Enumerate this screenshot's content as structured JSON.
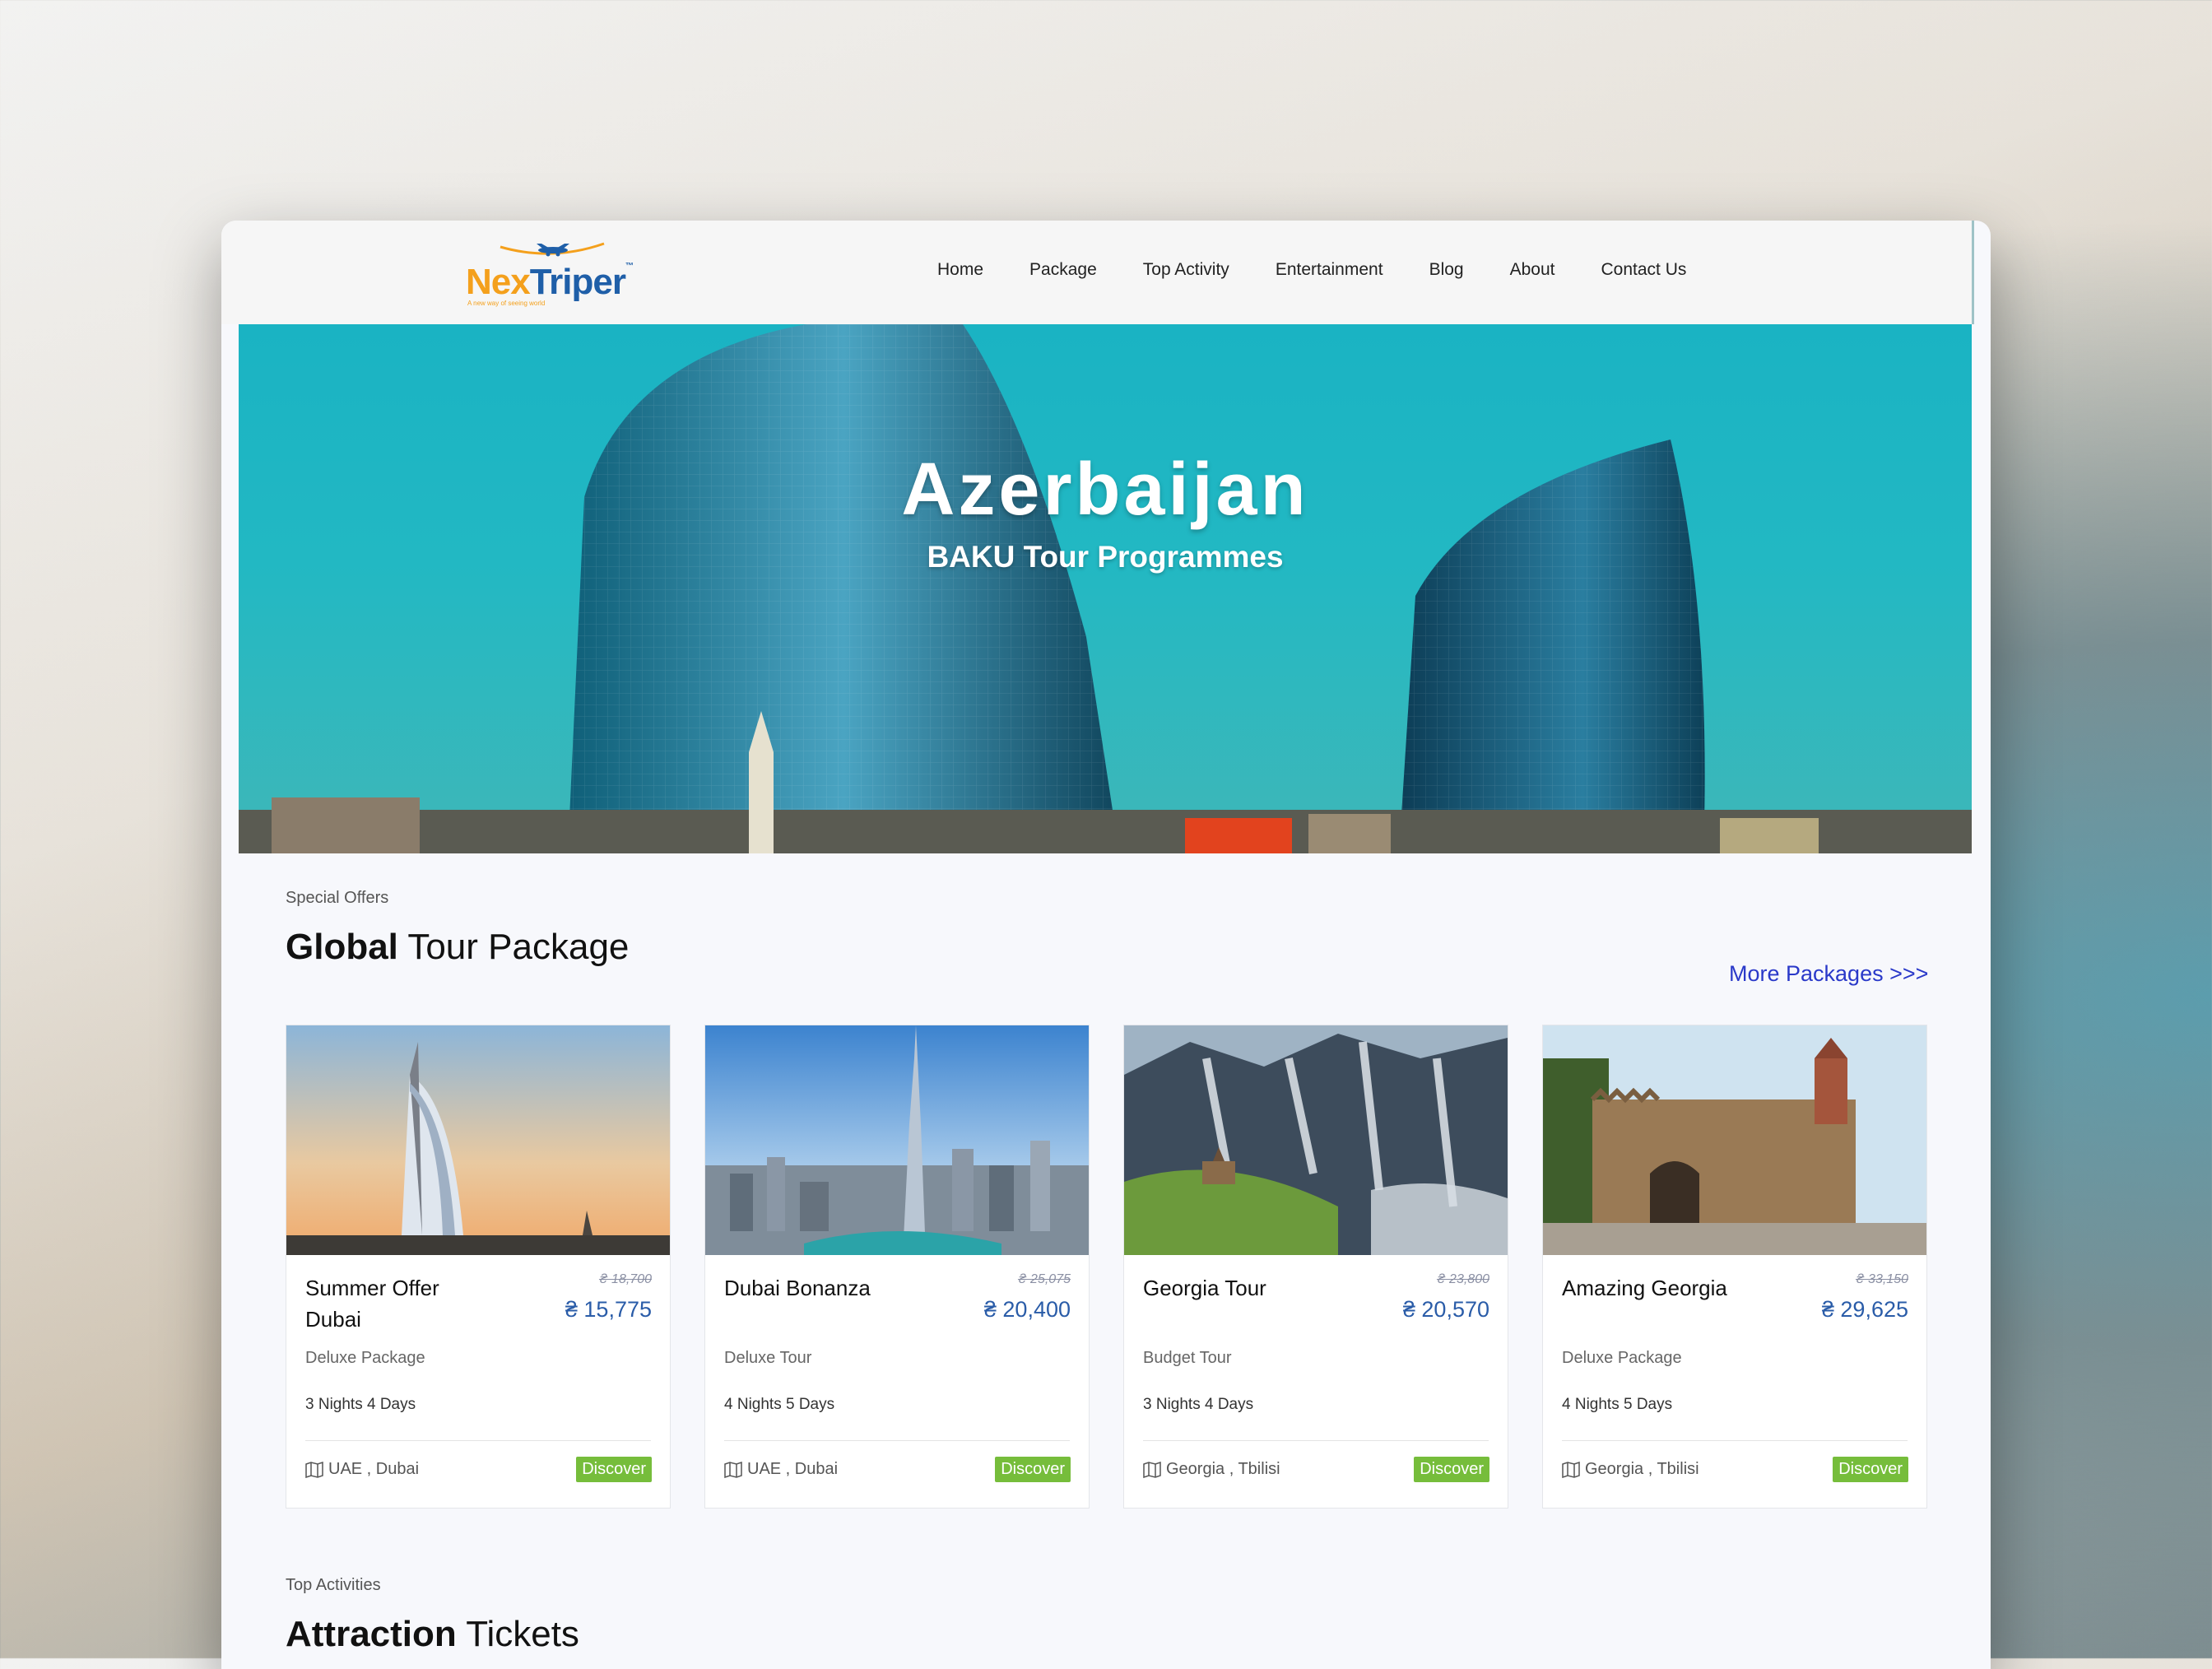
{
  "brand": {
    "name_part1": "Nex",
    "name_part2": "Triper",
    "tagline": "A new way of seeing world"
  },
  "nav": [
    "Home",
    "Package",
    "Top Activity",
    "Entertainment",
    "Blog",
    "About",
    "Contact Us"
  ],
  "hero": {
    "title": "Azerbaijan",
    "subtitle": "BAKU Tour Programmes"
  },
  "packages_section": {
    "eyebrow": "Special Offers",
    "title_bold": "Global",
    "title_rest": " Tour Package",
    "more_link": "More Packages >>>"
  },
  "packages": [
    {
      "name": "Summer Offer Dubai",
      "old_price": "₴ 18,700",
      "price": "₴ 15,775",
      "category": "Deluxe Package",
      "duration": "3 Nights 4 Days",
      "location": "UAE , Dubai",
      "button": "Discover"
    },
    {
      "name": "Dubai Bonanza",
      "old_price": "₴ 25,075",
      "price": "₴ 20,400",
      "category": "Deluxe Tour",
      "duration": "4 Nights 5 Days",
      "location": "UAE , Dubai",
      "button": "Discover"
    },
    {
      "name": "Georgia Tour",
      "old_price": "₴ 23,800",
      "price": "₴ 20,570",
      "category": "Budget Tour",
      "duration": "3 Nights 4 Days",
      "location": "Georgia , Tbilisi",
      "button": "Discover"
    },
    {
      "name": "Amazing Georgia",
      "old_price": "₴ 33,150",
      "price": "₴ 29,625",
      "category": "Deluxe Package",
      "duration": "4 Nights 5 Days",
      "location": "Georgia , Tbilisi",
      "button": "Discover"
    }
  ],
  "activities_section": {
    "eyebrow": "Top Activities",
    "title_bold": "Attraction",
    "title_rest": " Tickets"
  },
  "colors": {
    "accent": "#2a39c9",
    "price": "#2a5ca8",
    "discover": "#76bd3b",
    "hero_sky": "#1ab3c3",
    "logo_orange": "#f4a01c",
    "logo_blue": "#1f5fa8"
  },
  "icons": [
    "airplane-icon",
    "map-icon"
  ]
}
